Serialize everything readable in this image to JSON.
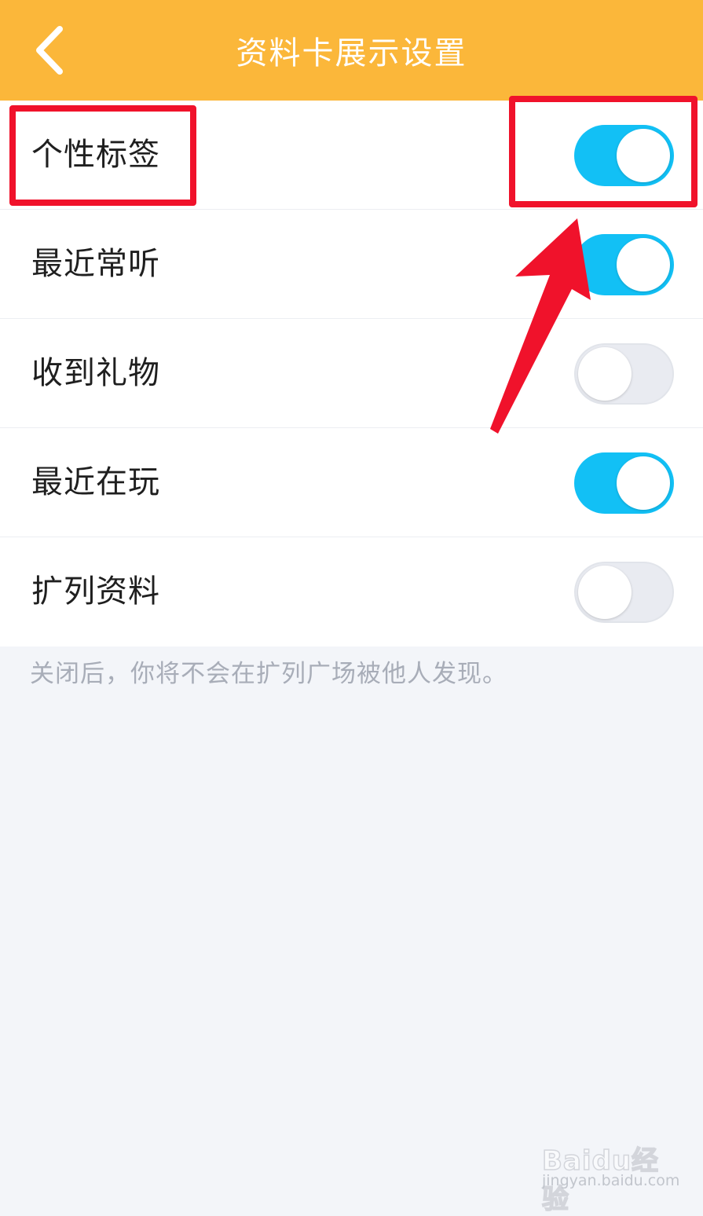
{
  "nav": {
    "title": "资料卡展示设置",
    "back_icon": "chevron-left-icon",
    "background_color": "#fbb73a"
  },
  "settings": [
    {
      "label": "个性标签",
      "enabled": true
    },
    {
      "label": "最近常听",
      "enabled": true
    },
    {
      "label": "收到礼物",
      "enabled": false
    },
    {
      "label": "最近在玩",
      "enabled": true
    },
    {
      "label": "扩列资料",
      "enabled": false
    }
  ],
  "footer_note": "关闭后，你将不会在扩列广场被他人发现。",
  "colors": {
    "toggle_on": "#12c0f5",
    "toggle_off": "#e9ebf1",
    "annotation": "#f0122b"
  },
  "watermark": {
    "brand": "Baidu经验",
    "url": "jingyan.baidu.com"
  }
}
